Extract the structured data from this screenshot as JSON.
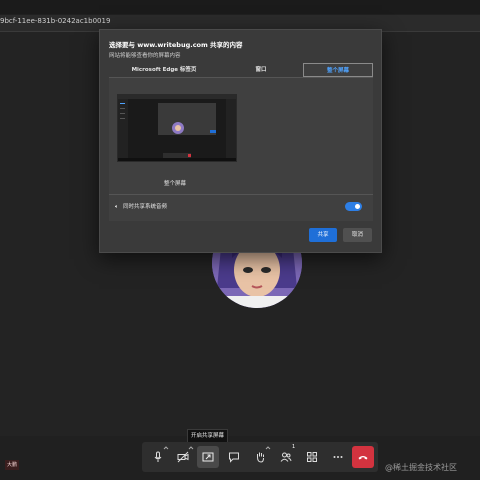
{
  "browser": {
    "url": "9bcf-11ee-831b-0242ac1b0019"
  },
  "dialog": {
    "title": "选择要与 www.writebug.com 共享的内容",
    "subtitle": "网站将能够查看你的屏幕内容",
    "tabs": [
      {
        "label": "Microsoft Edge 标签页"
      },
      {
        "label": "窗口"
      },
      {
        "label": "整个屏幕",
        "selected": true
      }
    ],
    "thumbnail_label": "整个屏幕",
    "audio_label": "同时共享系统音频",
    "audio_enabled": true,
    "share_button": "共享",
    "cancel_button": "取消"
  },
  "toolbar": {
    "tooltip": "开启共享屏幕",
    "participants_count": "1",
    "items": [
      {
        "icon": "microphone-icon"
      },
      {
        "icon": "camera-off-icon"
      },
      {
        "icon": "share-screen-icon"
      },
      {
        "icon": "chat-icon"
      },
      {
        "icon": "raise-hand-icon"
      },
      {
        "icon": "participants-icon"
      },
      {
        "icon": "apps-grid-icon"
      },
      {
        "icon": "more-icon"
      },
      {
        "icon": "end-call-icon"
      }
    ]
  },
  "badge": {
    "label": "大鹏"
  },
  "watermark": "@稀土掘金技术社区",
  "colors": {
    "accent": "#1f6fd8",
    "selected_tab": "#4fa3ff",
    "end_call": "#d3333f"
  }
}
